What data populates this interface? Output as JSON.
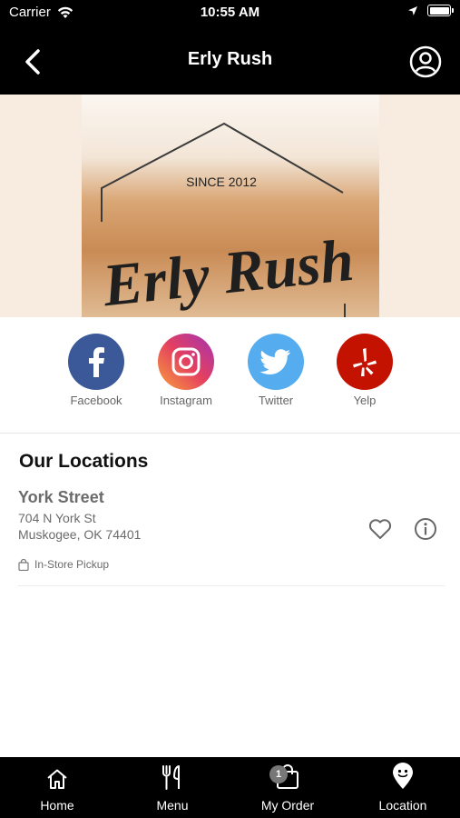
{
  "status_bar": {
    "carrier": "Carrier",
    "time": "10:55 AM"
  },
  "header": {
    "title": "Erly Rush"
  },
  "banner": {
    "since": "SINCE 2012",
    "logo_text": "Erly Rush"
  },
  "social": [
    {
      "label": "Facebook",
      "icon": "facebook-icon",
      "color": "#3b5998"
    },
    {
      "label": "Instagram",
      "icon": "instagram-icon",
      "color": "#d6249f"
    },
    {
      "label": "Twitter",
      "icon": "twitter-icon",
      "color": "#55acee"
    },
    {
      "label": "Yelp",
      "icon": "yelp-icon",
      "color": "#c41200"
    }
  ],
  "locations": {
    "title": "Our Locations",
    "items": [
      {
        "name": "York Street",
        "address_line1": "704 N York St",
        "address_line2": "Muskogee, OK 74401",
        "service": "In-Store Pickup"
      }
    ]
  },
  "tabbar": {
    "items": [
      {
        "label": "Home",
        "icon": "home-icon"
      },
      {
        "label": "Menu",
        "icon": "menu-utensils-icon"
      },
      {
        "label": "My Order",
        "icon": "shopping-bag-icon",
        "badge": "1"
      },
      {
        "label": "Location",
        "icon": "location-pin-icon"
      }
    ]
  }
}
